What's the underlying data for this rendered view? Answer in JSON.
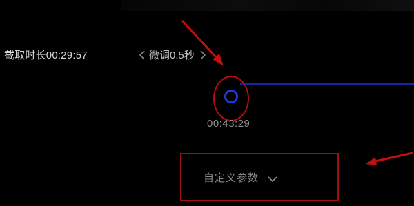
{
  "colors": {
    "background": "#000000",
    "accent_blue": "#1f3bd6",
    "annotation_red": "#c01010"
  },
  "capture": {
    "duration_label": "截取时长00:29:57",
    "fine_tune_label": "微调0.5秒",
    "current_time": "00:43:29",
    "faint_text": "",
    "custom_param_label": "自定义参数"
  },
  "icons": {
    "prev": "chevron-left-icon",
    "next": "chevron-right-icon",
    "dropdown": "chevron-down-icon"
  }
}
